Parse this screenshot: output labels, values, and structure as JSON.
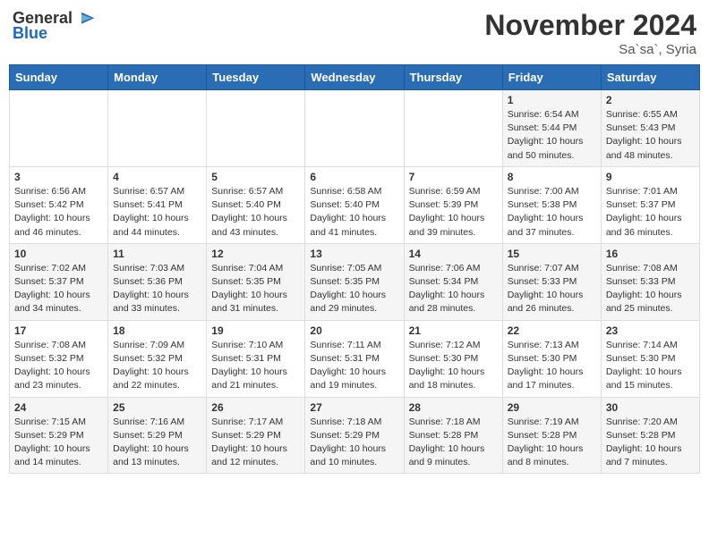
{
  "logo": {
    "general": "General",
    "blue": "Blue"
  },
  "title": "November 2024",
  "location": "Sa`sa`, Syria",
  "days_header": [
    "Sunday",
    "Monday",
    "Tuesday",
    "Wednesday",
    "Thursday",
    "Friday",
    "Saturday"
  ],
  "weeks": [
    [
      null,
      null,
      null,
      null,
      null,
      {
        "day": "1",
        "sunrise": "Sunrise: 6:54 AM",
        "sunset": "Sunset: 5:44 PM",
        "daylight": "Daylight: 10 hours and 50 minutes."
      },
      {
        "day": "2",
        "sunrise": "Sunrise: 6:55 AM",
        "sunset": "Sunset: 5:43 PM",
        "daylight": "Daylight: 10 hours and 48 minutes."
      }
    ],
    [
      {
        "day": "3",
        "sunrise": "Sunrise: 6:56 AM",
        "sunset": "Sunset: 5:42 PM",
        "daylight": "Daylight: 10 hours and 46 minutes."
      },
      {
        "day": "4",
        "sunrise": "Sunrise: 6:57 AM",
        "sunset": "Sunset: 5:41 PM",
        "daylight": "Daylight: 10 hours and 44 minutes."
      },
      {
        "day": "5",
        "sunrise": "Sunrise: 6:57 AM",
        "sunset": "Sunset: 5:40 PM",
        "daylight": "Daylight: 10 hours and 43 minutes."
      },
      {
        "day": "6",
        "sunrise": "Sunrise: 6:58 AM",
        "sunset": "Sunset: 5:40 PM",
        "daylight": "Daylight: 10 hours and 41 minutes."
      },
      {
        "day": "7",
        "sunrise": "Sunrise: 6:59 AM",
        "sunset": "Sunset: 5:39 PM",
        "daylight": "Daylight: 10 hours and 39 minutes."
      },
      {
        "day": "8",
        "sunrise": "Sunrise: 7:00 AM",
        "sunset": "Sunset: 5:38 PM",
        "daylight": "Daylight: 10 hours and 37 minutes."
      },
      {
        "day": "9",
        "sunrise": "Sunrise: 7:01 AM",
        "sunset": "Sunset: 5:37 PM",
        "daylight": "Daylight: 10 hours and 36 minutes."
      }
    ],
    [
      {
        "day": "10",
        "sunrise": "Sunrise: 7:02 AM",
        "sunset": "Sunset: 5:37 PM",
        "daylight": "Daylight: 10 hours and 34 minutes."
      },
      {
        "day": "11",
        "sunrise": "Sunrise: 7:03 AM",
        "sunset": "Sunset: 5:36 PM",
        "daylight": "Daylight: 10 hours and 33 minutes."
      },
      {
        "day": "12",
        "sunrise": "Sunrise: 7:04 AM",
        "sunset": "Sunset: 5:35 PM",
        "daylight": "Daylight: 10 hours and 31 minutes."
      },
      {
        "day": "13",
        "sunrise": "Sunrise: 7:05 AM",
        "sunset": "Sunset: 5:35 PM",
        "daylight": "Daylight: 10 hours and 29 minutes."
      },
      {
        "day": "14",
        "sunrise": "Sunrise: 7:06 AM",
        "sunset": "Sunset: 5:34 PM",
        "daylight": "Daylight: 10 hours and 28 minutes."
      },
      {
        "day": "15",
        "sunrise": "Sunrise: 7:07 AM",
        "sunset": "Sunset: 5:33 PM",
        "daylight": "Daylight: 10 hours and 26 minutes."
      },
      {
        "day": "16",
        "sunrise": "Sunrise: 7:08 AM",
        "sunset": "Sunset: 5:33 PM",
        "daylight": "Daylight: 10 hours and 25 minutes."
      }
    ],
    [
      {
        "day": "17",
        "sunrise": "Sunrise: 7:08 AM",
        "sunset": "Sunset: 5:32 PM",
        "daylight": "Daylight: 10 hours and 23 minutes."
      },
      {
        "day": "18",
        "sunrise": "Sunrise: 7:09 AM",
        "sunset": "Sunset: 5:32 PM",
        "daylight": "Daylight: 10 hours and 22 minutes."
      },
      {
        "day": "19",
        "sunrise": "Sunrise: 7:10 AM",
        "sunset": "Sunset: 5:31 PM",
        "daylight": "Daylight: 10 hours and 21 minutes."
      },
      {
        "day": "20",
        "sunrise": "Sunrise: 7:11 AM",
        "sunset": "Sunset: 5:31 PM",
        "daylight": "Daylight: 10 hours and 19 minutes."
      },
      {
        "day": "21",
        "sunrise": "Sunrise: 7:12 AM",
        "sunset": "Sunset: 5:30 PM",
        "daylight": "Daylight: 10 hours and 18 minutes."
      },
      {
        "day": "22",
        "sunrise": "Sunrise: 7:13 AM",
        "sunset": "Sunset: 5:30 PM",
        "daylight": "Daylight: 10 hours and 17 minutes."
      },
      {
        "day": "23",
        "sunrise": "Sunrise: 7:14 AM",
        "sunset": "Sunset: 5:30 PM",
        "daylight": "Daylight: 10 hours and 15 minutes."
      }
    ],
    [
      {
        "day": "24",
        "sunrise": "Sunrise: 7:15 AM",
        "sunset": "Sunset: 5:29 PM",
        "daylight": "Daylight: 10 hours and 14 minutes."
      },
      {
        "day": "25",
        "sunrise": "Sunrise: 7:16 AM",
        "sunset": "Sunset: 5:29 PM",
        "daylight": "Daylight: 10 hours and 13 minutes."
      },
      {
        "day": "26",
        "sunrise": "Sunrise: 7:17 AM",
        "sunset": "Sunset: 5:29 PM",
        "daylight": "Daylight: 10 hours and 12 minutes."
      },
      {
        "day": "27",
        "sunrise": "Sunrise: 7:18 AM",
        "sunset": "Sunset: 5:29 PM",
        "daylight": "Daylight: 10 hours and 10 minutes."
      },
      {
        "day": "28",
        "sunrise": "Sunrise: 7:18 AM",
        "sunset": "Sunset: 5:28 PM",
        "daylight": "Daylight: 10 hours and 9 minutes."
      },
      {
        "day": "29",
        "sunrise": "Sunrise: 7:19 AM",
        "sunset": "Sunset: 5:28 PM",
        "daylight": "Daylight: 10 hours and 8 minutes."
      },
      {
        "day": "30",
        "sunrise": "Sunrise: 7:20 AM",
        "sunset": "Sunset: 5:28 PM",
        "daylight": "Daylight: 10 hours and 7 minutes."
      }
    ]
  ]
}
